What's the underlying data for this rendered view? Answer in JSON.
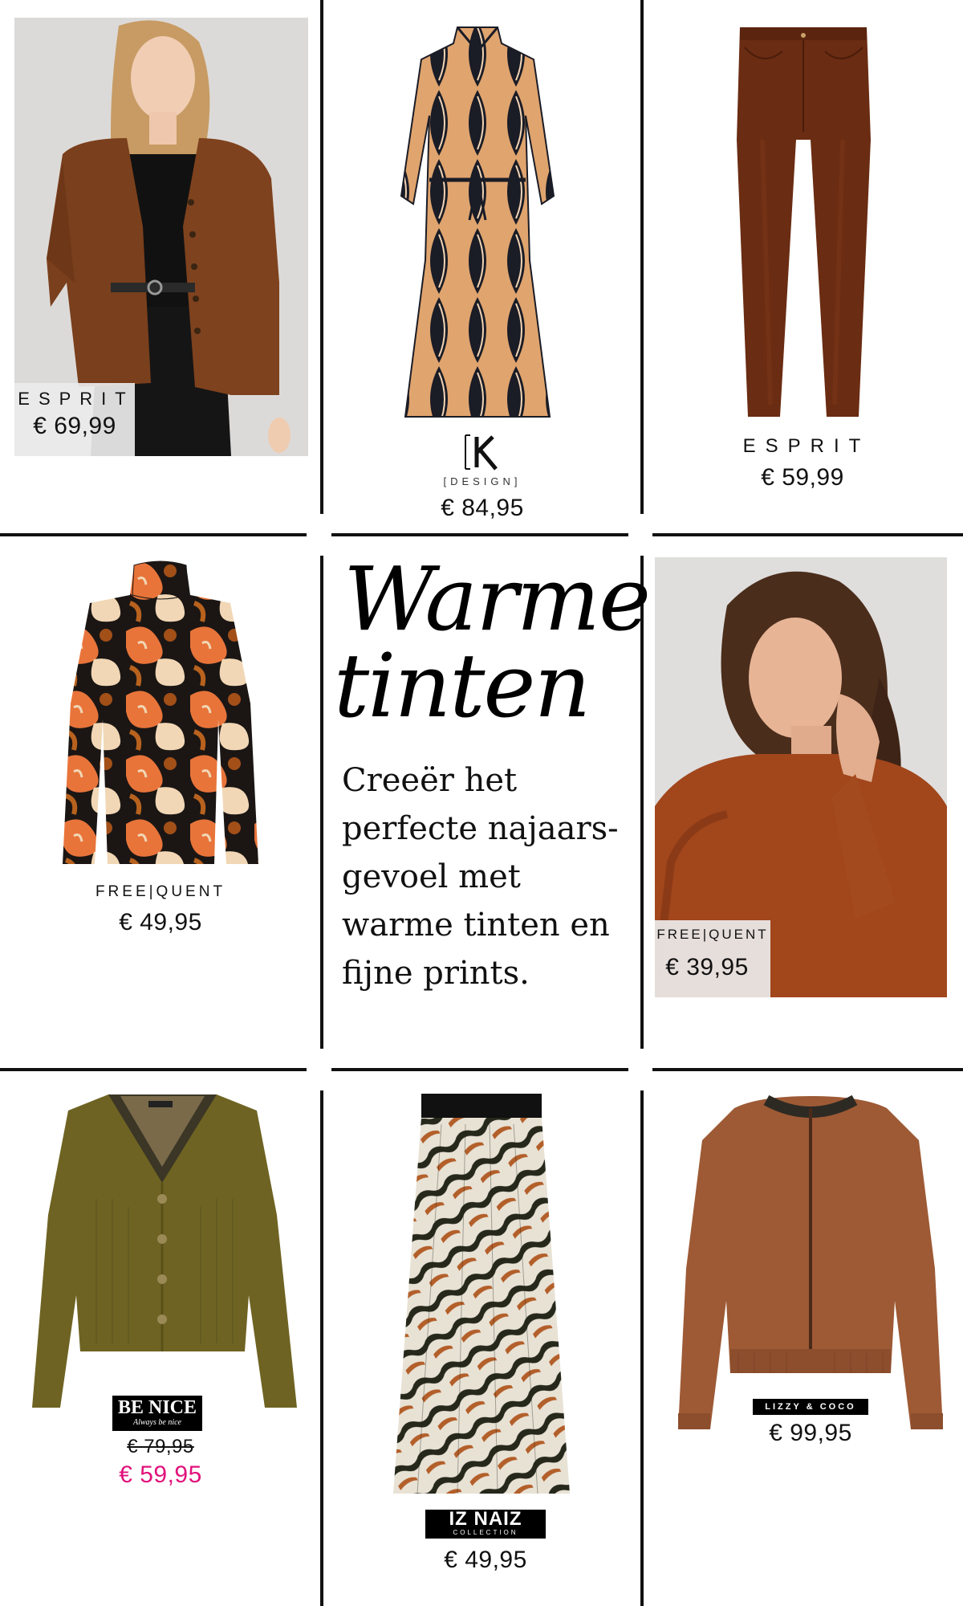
{
  "colors": {
    "sale": "#e0127c",
    "line": "#111111",
    "accent_brown": "#7a3a1a"
  },
  "title": {
    "line1": "Warme",
    "line2": "tinten"
  },
  "intro": "Creeër het perfecte najaars-gevoel met warme tinten en fijne prints.",
  "products": [
    {
      "brand": "ESPRIT",
      "price": "€ 69,99",
      "item": "cardigan-brown"
    },
    {
      "brand_k": "K",
      "brand_sub": "[DESIGN]",
      "price": "€ 84,95",
      "item": "printed-dress"
    },
    {
      "brand": "ESPRIT",
      "price": "€ 59,99",
      "item": "brown-trousers"
    },
    {
      "brand": "FREE|QUENT",
      "price": "€ 49,95",
      "item": "printed-blouse"
    },
    {
      "brand": "FREE|QUENT",
      "price": "€ 39,95",
      "item": "rust-blouse"
    },
    {
      "brand": "BE NICE",
      "brand_tag": "Always be nice",
      "old_price": "€ 79,95",
      "price": "€ 59,95",
      "item": "olive-cardigan"
    },
    {
      "brand": "IZ NAIZ",
      "brand_tag": "COLLECTION",
      "price": "€ 49,95",
      "item": "zebra-skirt"
    },
    {
      "brand": "LIZZY & COCO",
      "price": "€ 99,95",
      "item": "suede-jacket"
    }
  ]
}
